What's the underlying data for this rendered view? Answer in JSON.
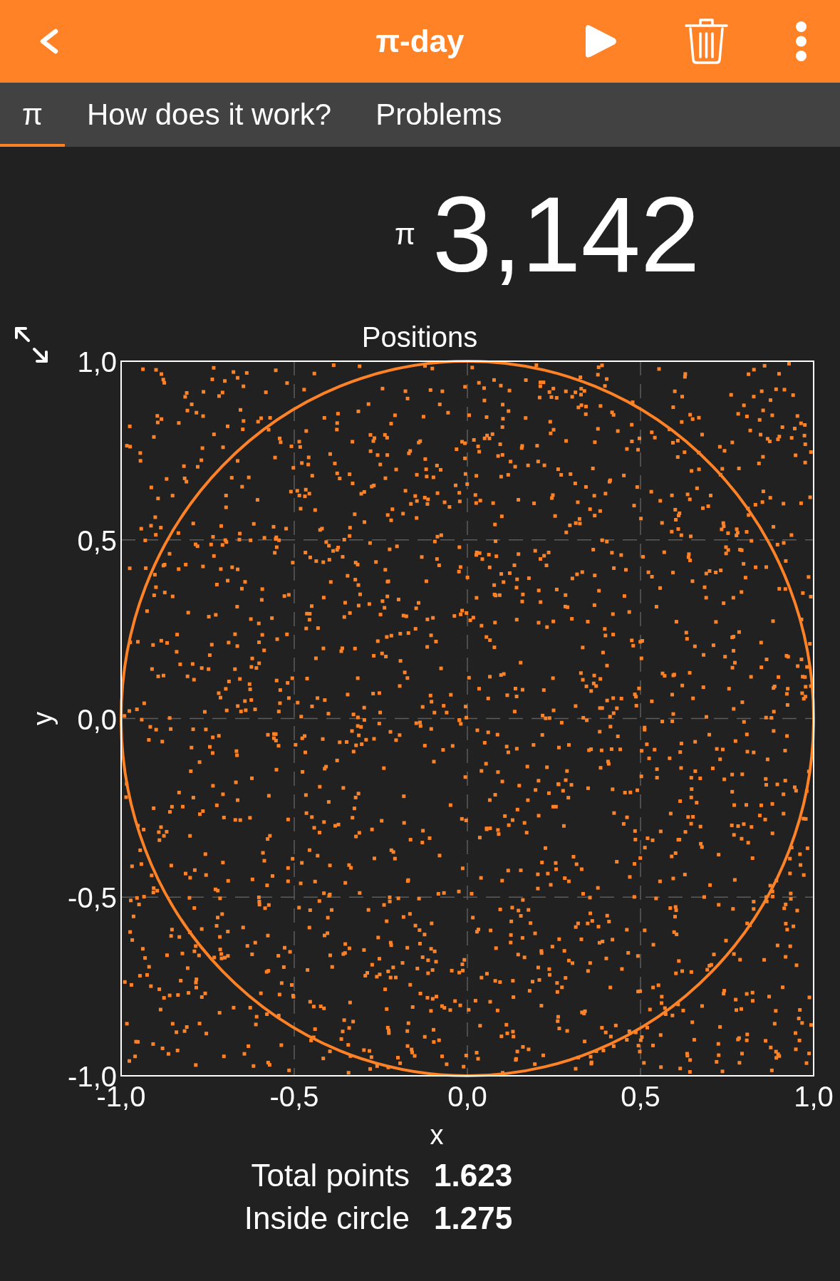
{
  "header": {
    "title": "π-day"
  },
  "tabs": [
    {
      "label": "π",
      "selected": true
    },
    {
      "label": "How does it work?",
      "selected": false
    },
    {
      "label": "Problems",
      "selected": false
    }
  ],
  "estimate": {
    "symbol": "π",
    "value": "3,142"
  },
  "plot": {
    "title": "Positions",
    "xlabel": "x",
    "ylabel": "y",
    "xticks": [
      "-1,0",
      "-0,5",
      "0,0",
      "0,5",
      "1,0"
    ],
    "yticks": [
      "1,0",
      "0,5",
      "0,0",
      "-0,5",
      "-1,0"
    ]
  },
  "stats": [
    {
      "label": "Total points",
      "value": "1.623"
    },
    {
      "label": "Inside circle",
      "value": "1.275"
    }
  ]
}
